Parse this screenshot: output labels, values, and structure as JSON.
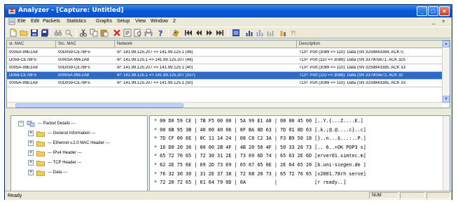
{
  "window": {
    "title": "Analyzer - [Capture: Untitled]"
  },
  "menubar": {
    "items": [
      "Eile",
      "Edit",
      "Packets",
      "Statistics",
      "Graphs",
      "Setup",
      "View",
      "Window",
      "2"
    ],
    "mdi_controls": [
      "_",
      "×"
    ]
  },
  "toolbar": {
    "icons": [
      "new-icon",
      "open-icon",
      "save-icon",
      "save-all-icon",
      "binoculars-icon",
      "find-icon",
      "cut-icon",
      "copy-icon",
      "paste-icon",
      "delete-icon",
      "filter-icon",
      "print-preview-icon",
      "print-icon",
      "help-icon",
      "capture-icon",
      "first-icon",
      "prev-icon",
      "next-icon",
      "last-icon",
      "list-icon",
      "chart-icon",
      "graph-icon",
      "graph2-icon",
      "stats-icon",
      "stats2-icon"
    ]
  },
  "packet_list": {
    "columns": [
      "st. MAC",
      "Src. MAC",
      "Network",
      "Description"
    ],
    "selected_index": 3,
    "rows": [
      [
        "0005A-99E1A8",
        "00D059-CE7BF5",
        "IP: 141.99.125.207 => 141.99.125.1 (48)",
        "TCP: Port (3089 => 110): Data (SN 3259843384, ACK 0,"
      ],
      [
        "D059-CE7BF5",
        "00005A-99E1A8",
        "IP: 141.99.125.1 => 141.99.125.207 (48)",
        "TCP: Port (110 => 3089): Data (SN 337905671, ACK 325"
      ],
      [
        "0005A-99E1A8",
        "00D059-CE7BF5",
        "IP: 141.99.125.207 => 141.99.125.1 (40)",
        "TCP: Port (3089 => 110): Data (SN 3259843385, ACK 33"
      ],
      [
        "D059-CE7BF5",
        "00005A-99E1A8",
        "IP: 141.99.125.1 => 141.99.125.207 (107)",
        "TCP: Port (110 => 3089): Data (SN 337905672, ACK 32"
      ],
      [
        "0005A-99E1A8",
        "00D059-CE7BF5",
        "IP: 141.99.125.207 => 141.99.125.1 (50)",
        "TCP: Port (3089 => 110): Data (SN 3259843385, ACK 33"
      ]
    ]
  },
  "tree": {
    "nodes": [
      {
        "label": "--- Packet Details ---",
        "expander": "−",
        "level": 0
      },
      {
        "label": "--- General Information ---",
        "expander": "+",
        "level": 1
      },
      {
        "label": "--- Ethernet v.2.0 MAC Header ---",
        "expander": "+",
        "level": 1
      },
      {
        "label": "--- IPv4 Header ---",
        "expander": "+",
        "level": 1
      },
      {
        "label": "--- TCP Header ---",
        "expander": "+",
        "level": 1
      },
      {
        "label": "--- Data ---",
        "expander": "+",
        "level": 1
      }
    ]
  },
  "hex_dump": {
    "rows": [
      "* 00 D0 59 CE | 7B F5 00 00 | 5A 99 E1 A8 | 08 00 45 00 [..Y.{...Z....E.]",
      "* 00 6B 95 3B | 40 00 40 06 | 8F BA 8D 63 | 7D 01 8D 63 [.k.;@.@....c}..c]",
      "* 7D CF 00 6E | 0C 11 14 24 | 08 C8 C2 3A | F3 B9 50 18 [}..n...$...:..P.]",
      "* 16 D0 20 36 | 00 00 2B 4F | 4B 20 50 4F | 50 33 20 73 [.. 6..+OK POP3 s]",
      "* 65 72 76 65 | 72 30 31 2E | 73 69 6D 74 | 65 63 2E 6D [erver01.simtec.m]",
      "* 62 2E 75 6E | 69 2D 73 69 | 65 67 65 6E | 2E 64 65 20 [b.uni-siegen.de ]",
      "* 76 32 30 30 | 31 2E 37 38 | 72 68 20 73 | 65 72 76 65 [v2001.78rh serve]",
      "* 72 20 72 65 | 61 64 79 0D | 0A          |             [r ready..]"
    ]
  },
  "status": {
    "text": "Ready",
    "indicator": "NUM"
  }
}
